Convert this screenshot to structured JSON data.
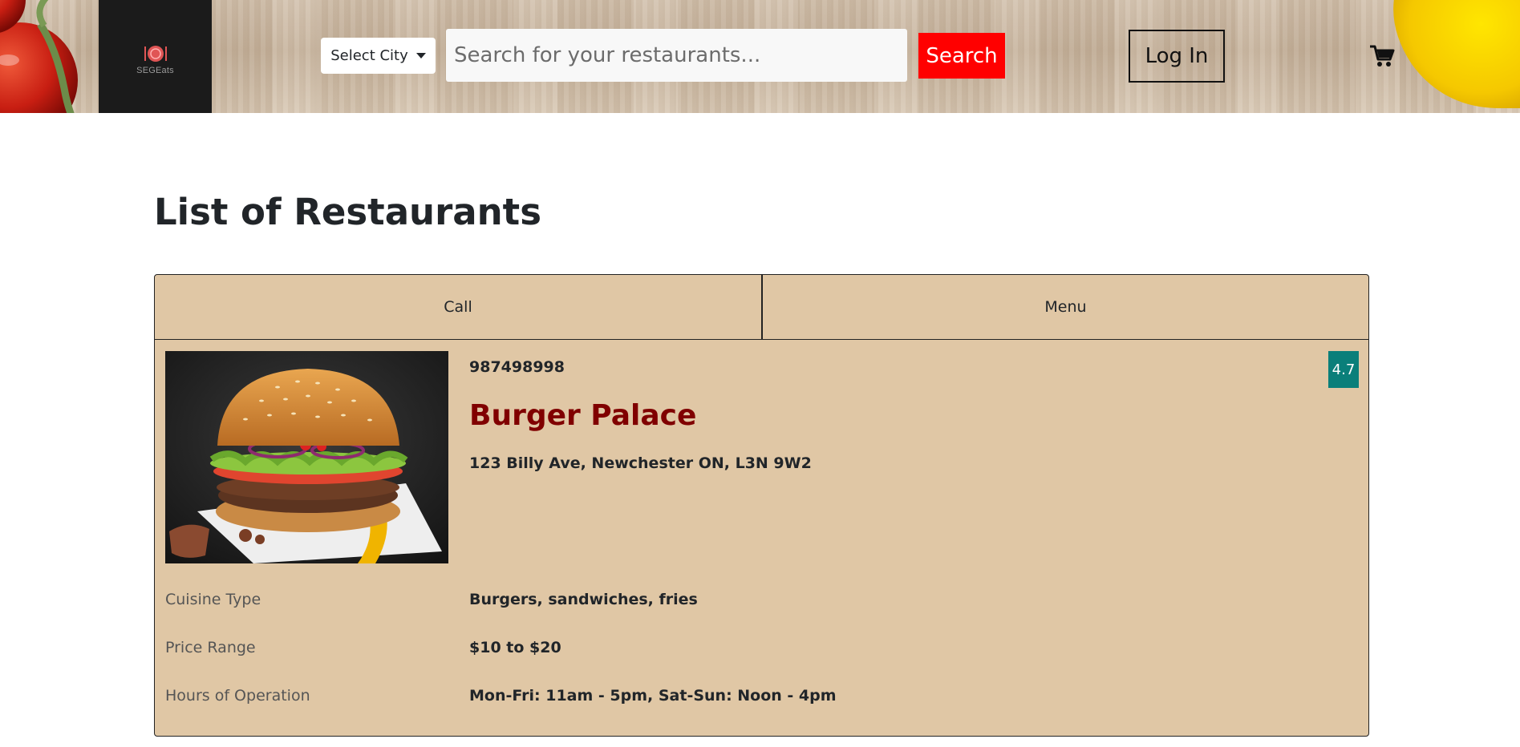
{
  "header": {
    "logo_text": "SEGEats",
    "city_select_label": "Select City",
    "search_placeholder": "Search for your restaurants...",
    "search_button_label": "Search",
    "login_label": "Log In",
    "cart_icon": "shopping-cart-icon"
  },
  "main": {
    "title": "List of Restaurants"
  },
  "restaurant": {
    "tabs": [
      {
        "label": "Call"
      },
      {
        "label": "Menu"
      }
    ],
    "phone": "987498998",
    "name": "Burger Palace",
    "address": "123 Billy Ave, Newchester ON, L3N 9W2",
    "rating": "4.7",
    "details": [
      {
        "label": "Cuisine Type",
        "value": "Burgers, sandwiches, fries"
      },
      {
        "label": "Price Range",
        "value": "$10 to $20"
      },
      {
        "label": "Hours of Operation",
        "value": "Mon-Fri: 11am - 5pm, Sat-Sun: Noon - 4pm"
      }
    ]
  },
  "colors": {
    "card_background": "#e0c7a5",
    "search_button": "#ff0000",
    "restaurant_name": "#800000",
    "rating_badge": "#0a7f7a",
    "logo_background": "#1b1b1b"
  }
}
